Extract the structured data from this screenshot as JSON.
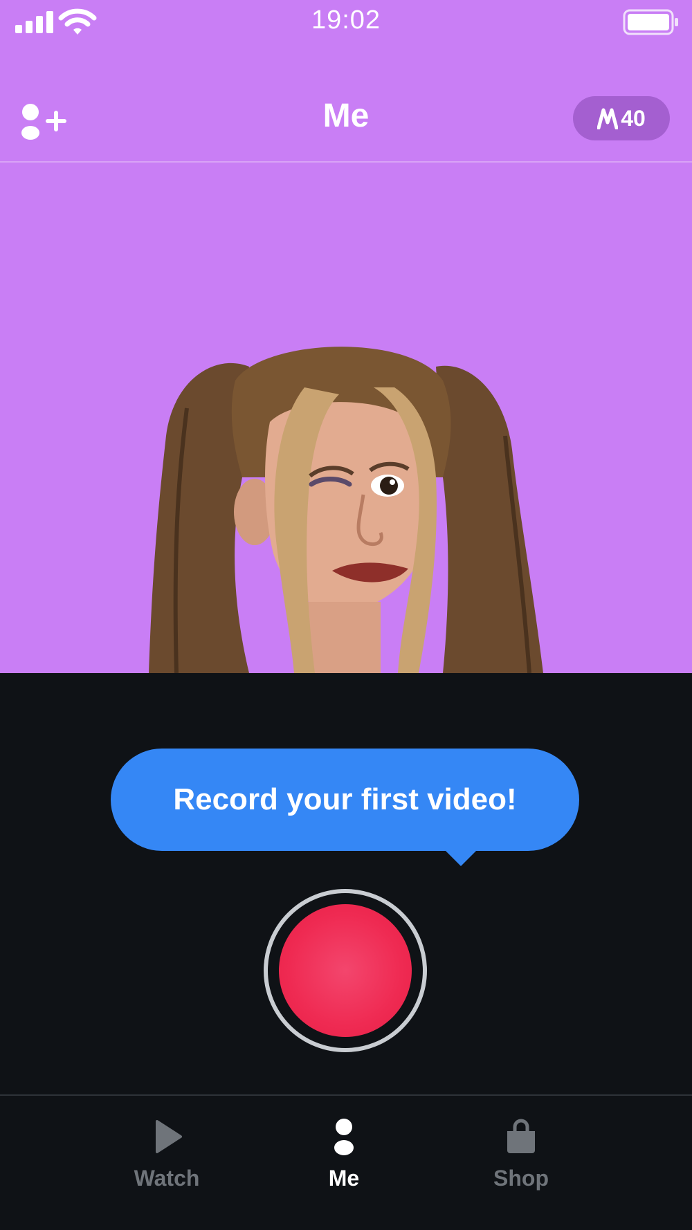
{
  "status_bar": {
    "time": "19:02"
  },
  "header": {
    "title": "Me",
    "coins": "40"
  },
  "tooltip": {
    "text": "Record your first video!"
  },
  "tabs": [
    {
      "label": "Watch",
      "icon": "play-icon",
      "active": false
    },
    {
      "label": "Me",
      "icon": "person-icon",
      "active": true
    },
    {
      "label": "Shop",
      "icon": "bag-icon",
      "active": false
    }
  ],
  "colors": {
    "top_background": "#c97ef5",
    "bottom_background": "#0f1216",
    "tooltip": "#3587f5",
    "record": "#ef2a52",
    "coin_badge": "#a45fd0"
  }
}
